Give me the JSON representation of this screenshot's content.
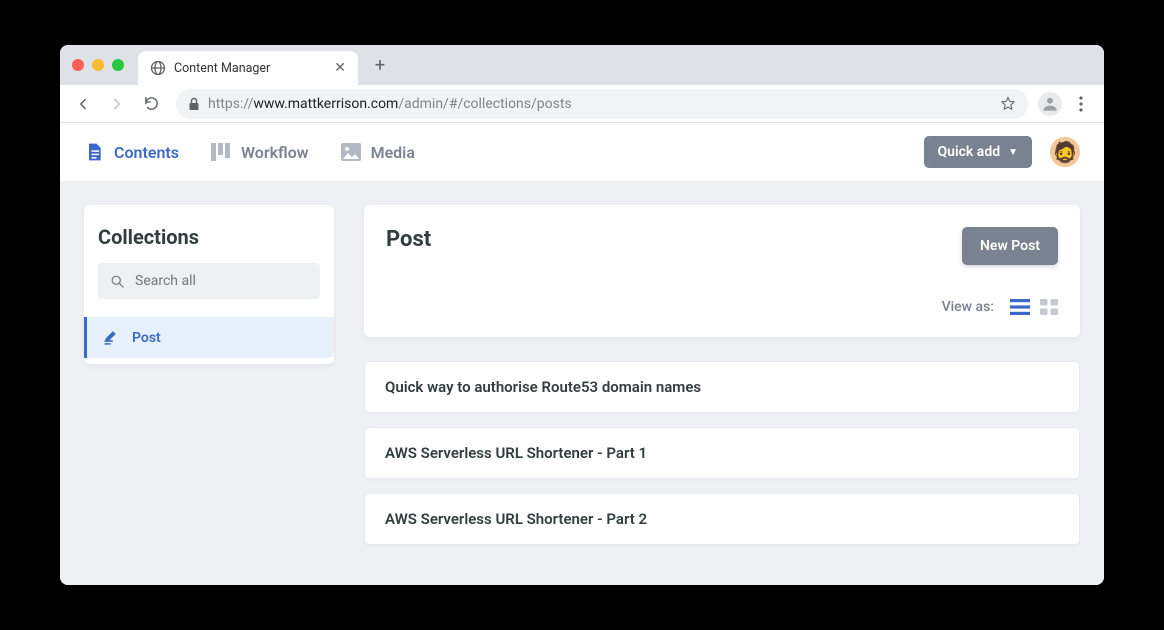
{
  "browser": {
    "tab_title": "Content Manager",
    "url_protocol": "https://",
    "url_host": "www.mattkerrison.com",
    "url_path": "/admin/#/collections/posts"
  },
  "header": {
    "nav": [
      {
        "label": "Contents",
        "active": true
      },
      {
        "label": "Workflow",
        "active": false
      },
      {
        "label": "Media",
        "active": false
      }
    ],
    "quick_add_label": "Quick add"
  },
  "sidebar": {
    "title": "Collections",
    "search_placeholder": "Search all",
    "items": [
      {
        "label": "Post",
        "active": true
      }
    ]
  },
  "main": {
    "title": "Post",
    "new_button": "New Post",
    "view_as_label": "View as:",
    "posts": [
      {
        "title": "Quick way to authorise Route53 domain names"
      },
      {
        "title": "AWS Serverless URL Shortener - Part 1"
      },
      {
        "title": "AWS Serverless URL Shortener - Part 2"
      }
    ]
  }
}
